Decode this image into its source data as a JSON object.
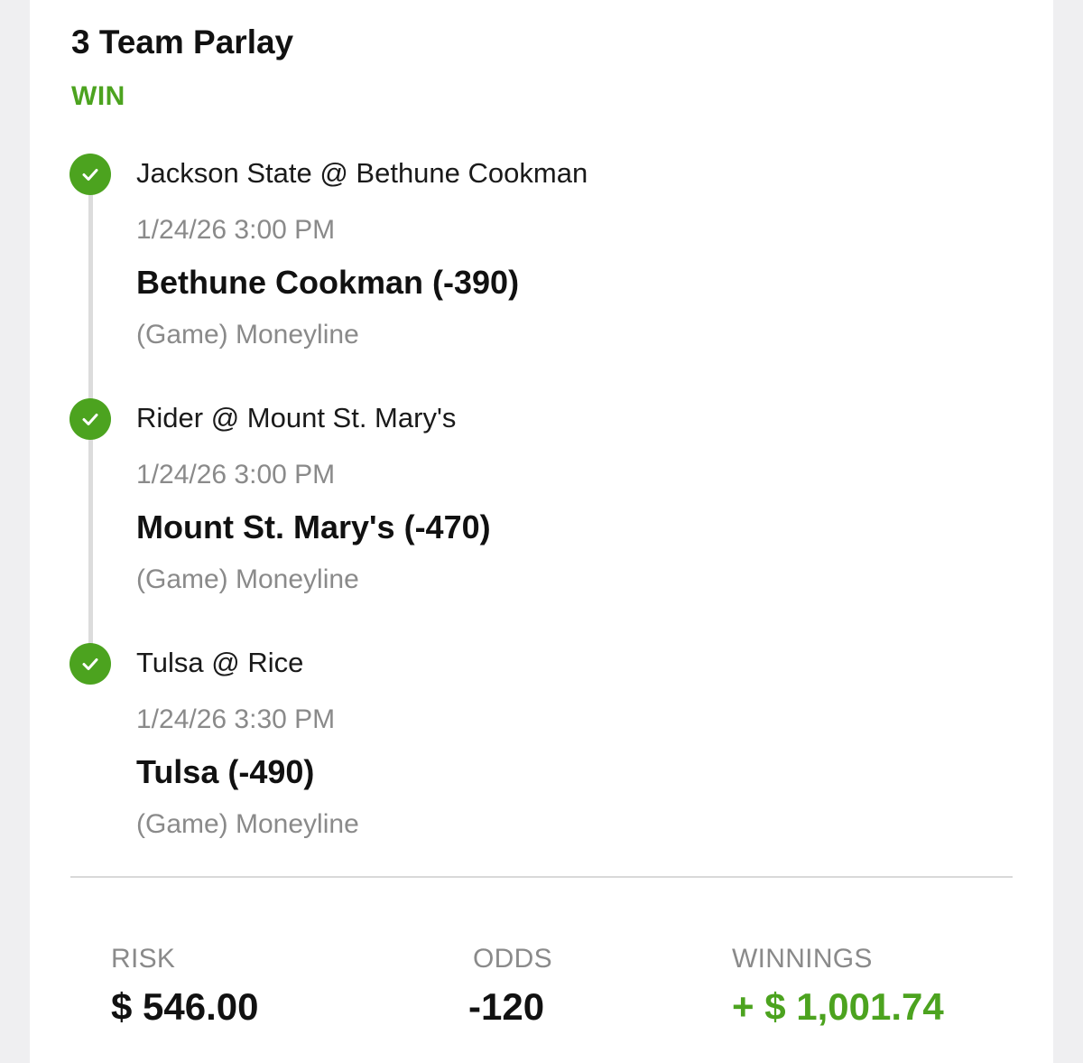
{
  "bet": {
    "title": "3 Team Parlay",
    "status": "WIN",
    "accent_color": "#4ca31f"
  },
  "legs": [
    {
      "matchup": "Jackson State @ Bethune Cookman",
      "datetime": "1/24/26 3:00 PM",
      "pick": "Bethune Cookman (-390)",
      "market": "(Game) Moneyline",
      "result_icon": "check-icon"
    },
    {
      "matchup": "Rider @ Mount St. Mary's",
      "datetime": "1/24/26 3:00 PM",
      "pick": "Mount St. Mary's (-470)",
      "market": "(Game) Moneyline",
      "result_icon": "check-icon"
    },
    {
      "matchup": "Tulsa @ Rice",
      "datetime": "1/24/26 3:30 PM",
      "pick": "Tulsa (-490)",
      "market": "(Game) Moneyline",
      "result_icon": "check-icon"
    }
  ],
  "summary": {
    "risk_label": "RISK",
    "risk_value": "$ 546.00",
    "odds_label": "ODDS",
    "odds_value": "-120",
    "winnings_label": "WINNINGS",
    "winnings_value": "+ $ 1,001.74"
  }
}
